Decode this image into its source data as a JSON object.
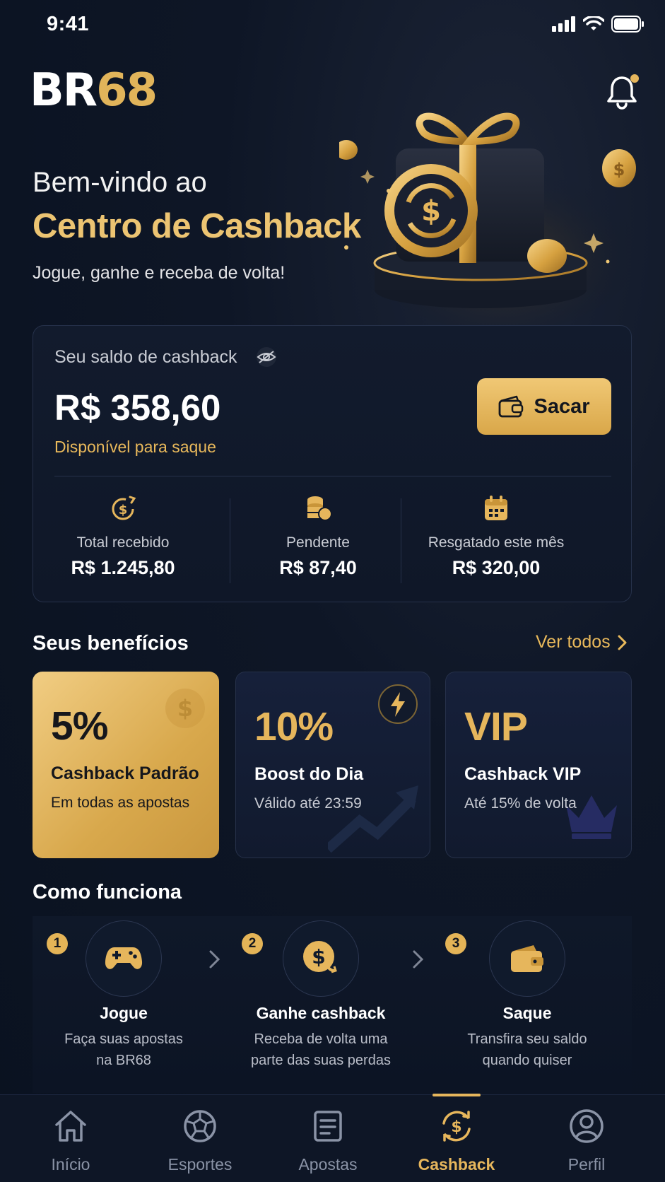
{
  "status_bar": {
    "time": "9:41"
  },
  "brand": {
    "logo_left": "BR",
    "logo_right": "68"
  },
  "hero": {
    "subtitle": "Bem-vindo ao",
    "title": "Centro de Cashback",
    "tagline": "Jogue, ganhe e receba de volta!"
  },
  "balance": {
    "label": "Seu saldo de cashback",
    "value": "R$ 358,60",
    "available": "Disponível para saque",
    "withdraw_label": "Sacar",
    "stats": [
      {
        "label": "Total recebido",
        "value": "R$ 1.245,80",
        "icon": "cashback-coin-icon"
      },
      {
        "label": "Pendente",
        "value": "R$ 87,40",
        "icon": "coins-stack-icon"
      },
      {
        "label": "Resgatado este mês",
        "value": "R$ 320,00",
        "icon": "calendar-icon"
      }
    ]
  },
  "benefits": {
    "title": "Seus benefícios",
    "see_all": "Ver todos",
    "items": [
      {
        "big": "5%",
        "title": "Cashback Padrão",
        "subtitle": "Em todas as apostas"
      },
      {
        "big": "10%",
        "title": "Boost do Dia",
        "subtitle": "Válido até 23:59"
      },
      {
        "big": "VIP",
        "title": "Cashback VIP",
        "subtitle": "Até 15% de volta"
      }
    ]
  },
  "how": {
    "title": "Como funciona",
    "steps": [
      {
        "num": "1",
        "title": "Jogue",
        "desc1": "Faça suas apostas",
        "desc2": "na BR68",
        "icon": "gamepad-icon"
      },
      {
        "num": "2",
        "title": "Ganhe cashback",
        "desc1": "Receba de volta uma",
        "desc2": "parte das suas perdas",
        "icon": "dollar-coin-icon"
      },
      {
        "num": "3",
        "title": "Saque",
        "desc1": "Transfira seu saldo",
        "desc2": "quando quiser",
        "icon": "wallet-icon"
      }
    ]
  },
  "nav": {
    "items": [
      {
        "label": "Início",
        "icon": "home-icon"
      },
      {
        "label": "Esportes",
        "icon": "soccer-ball-icon"
      },
      {
        "label": "Apostas",
        "icon": "ticket-icon"
      },
      {
        "label": "Cashback",
        "icon": "cashback-icon",
        "active": true
      },
      {
        "label": "Perfil",
        "icon": "user-icon"
      }
    ]
  },
  "colors": {
    "accent": "#e6b65c",
    "background": "#0b1322",
    "card_border": "#26314a"
  }
}
